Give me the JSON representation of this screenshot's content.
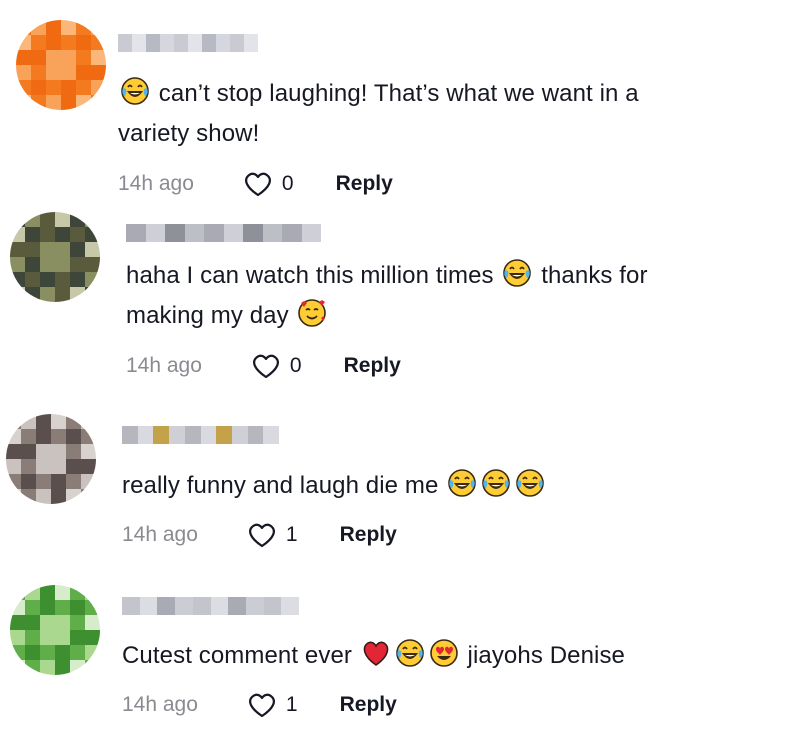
{
  "comments": [
    {
      "text_parts": [
        {
          "emoji": "face-with-tears-of-joy"
        },
        {
          "t": " can’t stop laughing! That’s what we want in a"
        },
        {
          "br": true
        },
        {
          "t": "variety show!"
        }
      ],
      "time": "14h ago",
      "likes": "0",
      "reply_label": "Reply",
      "avatar_colors": [
        "#f47a1f",
        "#f9a35a",
        "#ef6a10",
        "#fbb77a"
      ],
      "username_colors": [
        "#c9cad2",
        "#e3e4ea",
        "#b7b9c3",
        "#d6d7de"
      ]
    },
    {
      "text_parts": [
        {
          "t": "haha I can watch this million times "
        },
        {
          "emoji": "face-with-tears-of-joy"
        },
        {
          "t": " thanks for"
        },
        {
          "br": true
        },
        {
          "t": "making my day "
        },
        {
          "emoji": "smiling-face-with-hearts"
        }
      ],
      "time": "14h ago",
      "likes": "0",
      "reply_label": "Reply",
      "avatar_colors": [
        "#3d4638",
        "#8a8f62",
        "#5a5a3c",
        "#c6c8a8"
      ],
      "username_colors": [
        "#a9aab3",
        "#cfd0d7",
        "#8e909a",
        "#bdbfc7"
      ]
    },
    {
      "text_parts": [
        {
          "t": "really funny and laugh die me "
        },
        {
          "emoji": "face-with-tears-of-joy"
        },
        {
          "emoji": "face-with-tears-of-joy"
        },
        {
          "emoji": "face-with-tears-of-joy"
        }
      ],
      "time": "14h ago",
      "likes": "1",
      "reply_label": "Reply",
      "avatar_colors": [
        "#8a7d78",
        "#c9c2bf",
        "#5a4f4d",
        "#d8d2cf"
      ],
      "username_colors": [
        "#b5b6be",
        "#d9dae0",
        "#c4a24a",
        "#cfd0d6"
      ]
    },
    {
      "text_parts": [
        {
          "t": "Cutest comment ever "
        },
        {
          "emoji": "red-heart"
        },
        {
          "emoji": "face-with-tears-of-joy"
        },
        {
          "emoji": "smiling-face-with-heart-eyes"
        },
        {
          "t": " jiayohs Denise"
        }
      ],
      "time": "14h ago",
      "likes": "1",
      "reply_label": "Reply",
      "avatar_colors": [
        "#5fae4a",
        "#a9d88e",
        "#3d8f30",
        "#d7eccb"
      ],
      "username_colors": [
        "#c3c4cc",
        "#dcdde3",
        "#a8aab4",
        "#cccdd4"
      ]
    }
  ]
}
